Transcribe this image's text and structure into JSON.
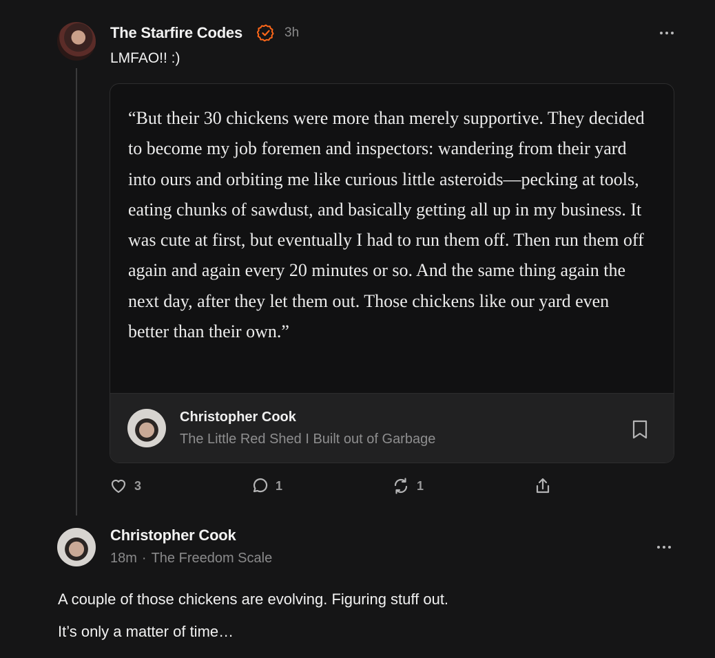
{
  "post": {
    "author": "The Starfire Codes",
    "time": "3h",
    "text": "LMFAO!! :)",
    "quote": {
      "text": "“But their 30 chickens were more than merely supportive. They decided to become my job foremen and inspectors: wandering from their yard into ours and orbiting me like curious little asteroids—pecking at tools, eating chunks of sawdust, and basically getting all up in my business. It was cute at first, but eventually I had to run them off. Then run them off again and again every 20 minutes or so. And the same thing again the next day, after they let them out. Those chickens like our yard even better than their own.”",
      "source_author": "Christopher Cook",
      "source_title": "The Little Red Shed I Built out of Garbage"
    },
    "actions": {
      "likes": "3",
      "comments": "1",
      "restacks": "1"
    },
    "icons": {
      "verified": "verified-check-icon",
      "like": "heart-icon",
      "comment": "comment-bubble-icon",
      "restack": "restack-icon",
      "share": "share-icon",
      "bookmark": "bookmark-icon",
      "more": "more-dots-icon"
    }
  },
  "reply": {
    "author": "Christopher Cook",
    "time": "18m",
    "separator": "·",
    "publication": "The Freedom Scale",
    "line1": "A couple of those chickens are evolving. Figuring stuff out.",
    "line2": "It’s only a matter of time…"
  },
  "colors": {
    "background": "#151516",
    "verified": "#ff6719",
    "muted": "#8a8a8b"
  }
}
